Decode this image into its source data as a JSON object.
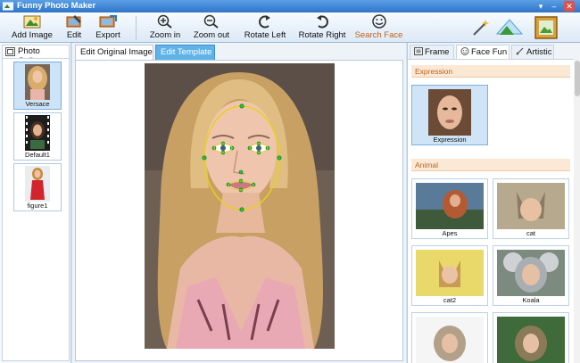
{
  "window": {
    "title": "Funny Photo Maker"
  },
  "toolbar": {
    "add_image": "Add Image",
    "edit": "Edit",
    "export": "Export",
    "zoom_in": "Zoom in",
    "zoom_out": "Zoom out",
    "rotate_left": "Rotate Left",
    "rotate_right": "Rotate Right",
    "search_face": "Search Face"
  },
  "left_panel": {
    "tab_label": "Photo Gallery",
    "items": [
      {
        "label": "Versace",
        "selected": true
      },
      {
        "label": "Default1",
        "selected": false
      },
      {
        "label": "figure1",
        "selected": false
      }
    ]
  },
  "center": {
    "tabs": [
      {
        "label": "Edit Original Image",
        "active": false
      },
      {
        "label": "Edit Template",
        "active": true
      }
    ]
  },
  "right_panel": {
    "tabs": [
      {
        "label": "Frame",
        "active": false
      },
      {
        "label": "Face Fun",
        "active": true
      },
      {
        "label": "Artistic",
        "active": false
      }
    ],
    "sections": [
      {
        "title": "Expression",
        "items": [
          {
            "label": "Expression",
            "selected": true
          }
        ]
      },
      {
        "title": "Animal",
        "items": [
          {
            "label": "Apes"
          },
          {
            "label": "cat"
          },
          {
            "label": "cat2"
          },
          {
            "label": "Koala"
          },
          {
            "label": ""
          },
          {
            "label": ""
          }
        ]
      }
    ]
  },
  "colors": {
    "accent": "#5fb3e8",
    "section_bg": "#fbe9d6",
    "section_text": "#c0601a",
    "face_outline": "#e6d21a",
    "landmark": "#27c23a"
  }
}
